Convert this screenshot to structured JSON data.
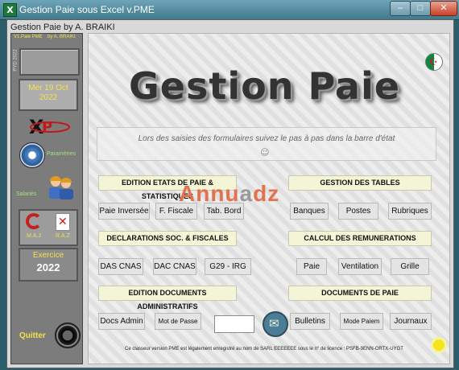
{
  "window": {
    "title": "Gestion Paie sous Excel v.PME",
    "min": "–",
    "max": "□",
    "close": "✕"
  },
  "form": {
    "title": "Gestion Paie by A. BRAIKI",
    "flag_glyph": "⚐"
  },
  "sidebar": {
    "version": "V1.Paie PME",
    "author": "by A. BRAIKI",
    "vertical": "PYD 2022",
    "date_line1": "Mer 19 Oct",
    "date_line2": "2022",
    "parametres": "Paramètres",
    "salaries": "Salariés",
    "maj": "M.A.J",
    "raz": "R.A.Z",
    "exercice_label": "Exercice",
    "exercice_year": "2022",
    "quitter": "Quitter"
  },
  "main": {
    "title": "Gestion Paie",
    "message": "Lors des saisies des formulaires suivez le pas à pas dans la barre d'état",
    "smiley": "☺",
    "watermark": {
      "a": "Annu",
      "o": "a",
      "b": "dz"
    },
    "sections": {
      "etats": "EDITION ETATS DE PAIE & STATISTIQUES",
      "tables": "GESTION DES TABLES",
      "declarations": "DECLARATIONS SOC. & FISCALES",
      "calcul": "CALCUL DES REMUNERATIONS",
      "docs_admin": "EDITION DOCUMENTS ADMINISTRATIFS",
      "docs_paie": "DOCUMENTS DE PAIE"
    },
    "buttons": {
      "paie_inversee": "Paie Inversée",
      "f_fiscale": "F. Fiscale",
      "tab_bord": "Tab. Bord",
      "banques": "Banques",
      "postes": "Postes",
      "rubriques": "Rubriques",
      "das_cnas": "DAS CNAS",
      "dac_cnas": "DAC CNAS",
      "g29_irg": "G29 - IRG",
      "paie": "Paie",
      "ventilation": "Ventilation",
      "grille": "Grille",
      "docs_admin": "Docs Admin",
      "mot_de_passe": "Mot de Passe",
      "bulletins": "Bulletins",
      "mode_paiem": "Mode Paiem",
      "journaux": "Journaux"
    },
    "footer": "Ce classeur version PME est légalement enregistré au nom de SARL EEEEEEE sous le n° de licence : PSFB-9ENN-ORTX-UYGT"
  }
}
